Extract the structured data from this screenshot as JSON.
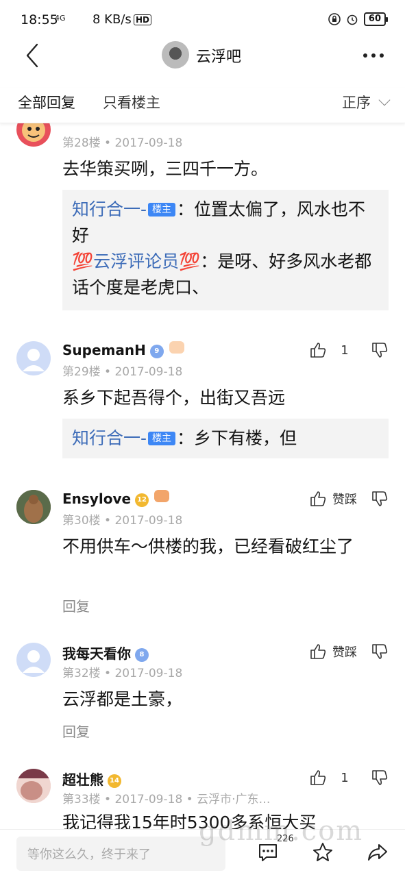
{
  "status": {
    "time": "18:55",
    "network": "4G",
    "speed": "8 KB/s",
    "hd": "HD",
    "battery": "60"
  },
  "header": {
    "forum_name": "云浮吧"
  },
  "tabs": {
    "all": "全部回复",
    "host_only": "只看楼主",
    "sort": "正序"
  },
  "posts": [
    {
      "floor_meta": "第28楼 • 2017-09-18",
      "content": "去华策买咧，三四千一方。",
      "replies": [
        {
          "name": "知行合一-",
          "badge": "楼主",
          "text": "：位置太偏了，风水也不好"
        },
        {
          "name": "💯云浮评论员💯",
          "text": "：是呀、好多风水老都话个度是老虎口、"
        }
      ]
    },
    {
      "username": "SupemanH",
      "level": "9",
      "floor_meta": "第29楼 • 2017-09-18",
      "likes": "1",
      "content": "系乡下起吾得个，出街又吾远",
      "replies": [
        {
          "name": "知行合一-",
          "badge": "楼主",
          "text": "：乡下有楼，但"
        }
      ]
    },
    {
      "username": "Ensylove",
      "level": "12",
      "floor_meta": "第30楼 • 2017-09-18",
      "likes": "赞踩",
      "content": "不用供车～供楼的我，已经看破红尘了",
      "reply_link": "回复"
    },
    {
      "username": "我每天看你",
      "level": "8",
      "floor_meta": "第32楼 • 2017-09-18",
      "likes": "赞踩",
      "content": "云浮都是土豪，",
      "reply_link": "回复"
    },
    {
      "username": "超壮熊",
      "level": "14",
      "floor_meta": "第33楼 • 2017-09-18 • 云浮市·广东…",
      "likes": "1",
      "content": "我记得我15年时5300多系恒大买"
    }
  ],
  "bottom": {
    "placeholder": "等你这么久，终于来了",
    "comment_count": "226"
  },
  "watermark": "gdmm.com",
  "colors": {
    "link_blue": "#3d6cb8",
    "host_badge": "#3d87f5",
    "meta_gray": "#a8a8a8"
  }
}
